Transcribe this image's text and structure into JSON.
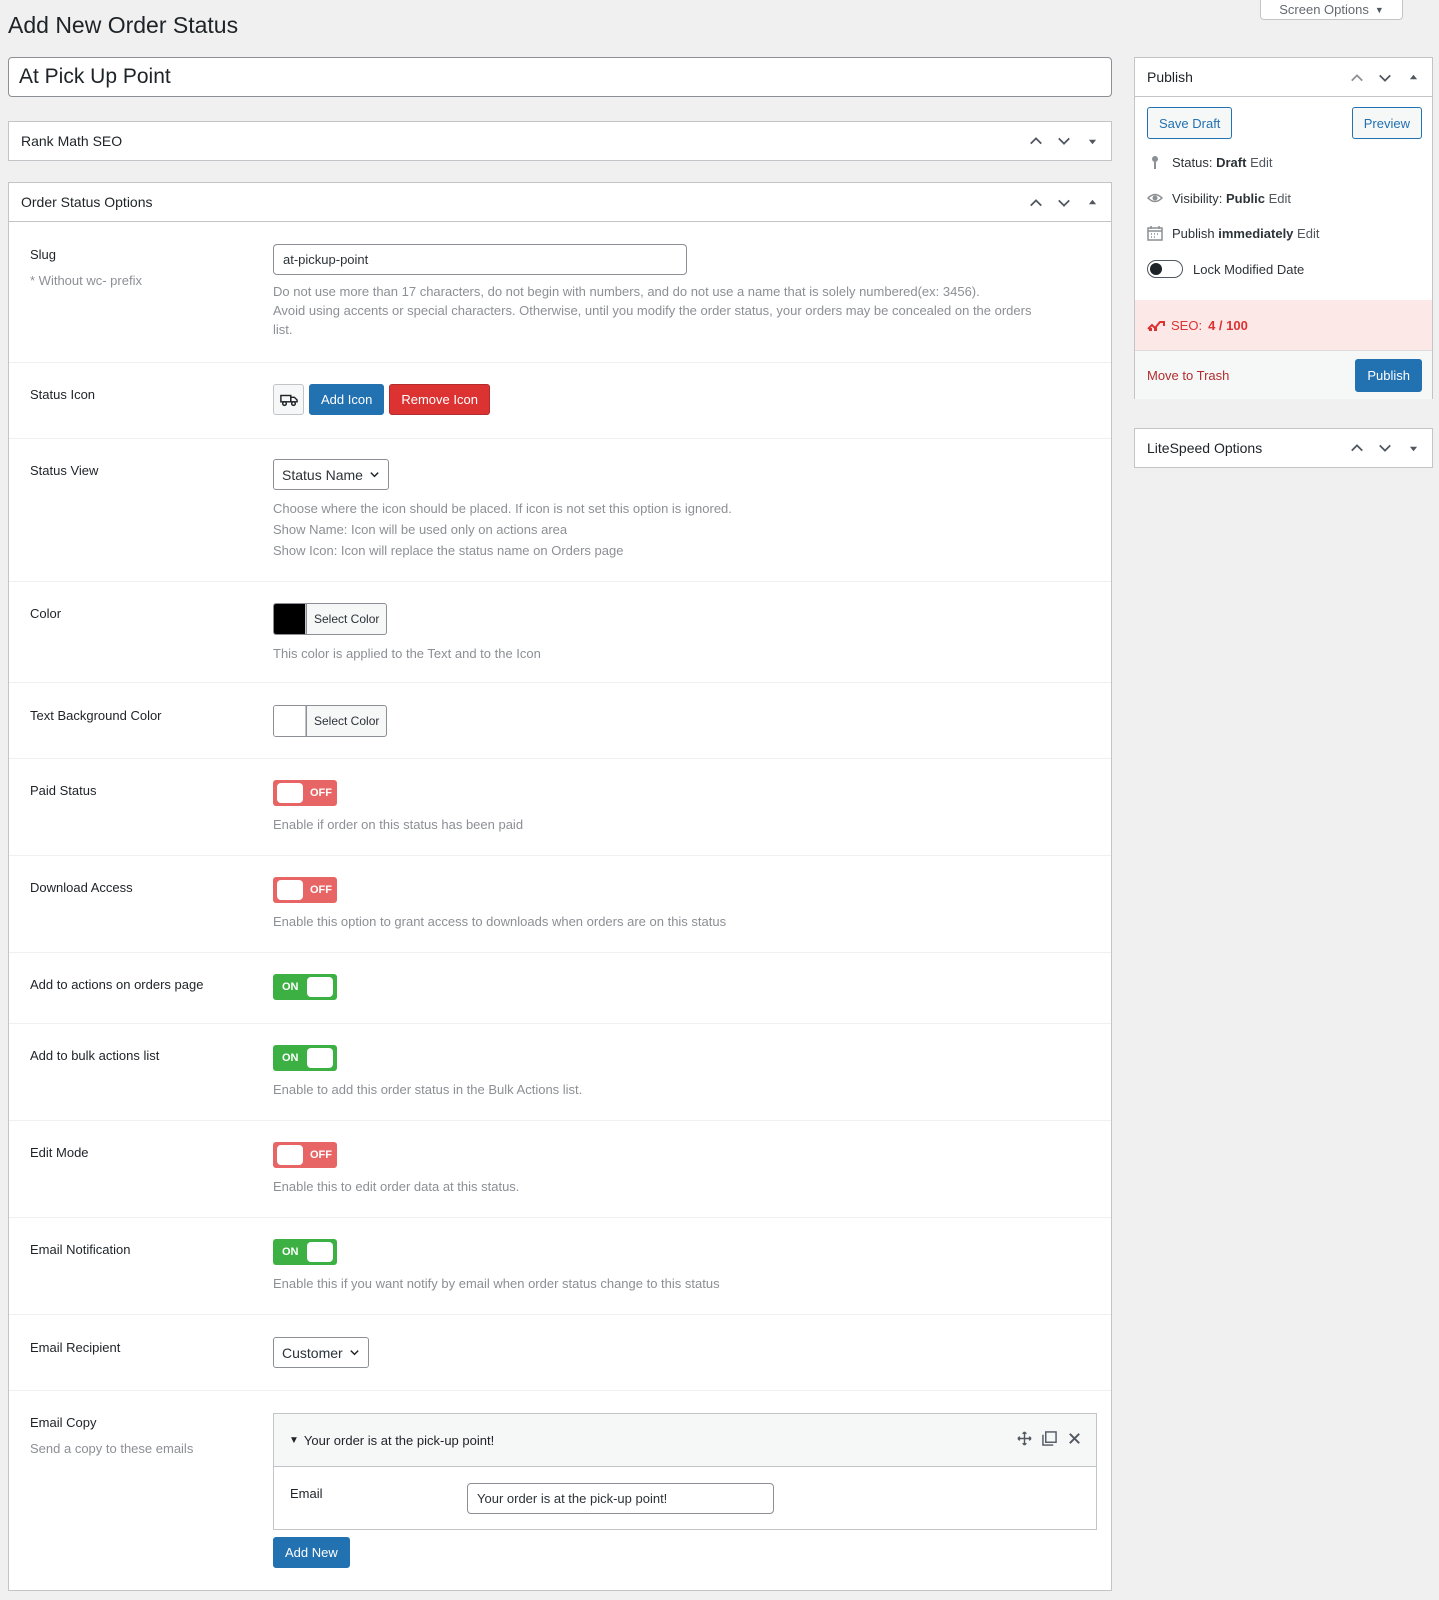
{
  "header": {
    "screen_options": "Screen Options",
    "page_title": "Add New Order Status"
  },
  "title_input": {
    "value": "At Pick Up Point"
  },
  "rank_math": {
    "title": "Rank Math SEO"
  },
  "order_status_options": {
    "title": "Order Status Options",
    "slug": {
      "label": "Slug",
      "sublabel": "* Without wc- prefix",
      "value": "at-pickup-point",
      "desc1": "Do not use more than 17 characters, do not begin with numbers, and do not use a name that is solely numbered(ex: 3456).",
      "desc2": "Avoid using accents or special characters. Otherwise, until you modify the order status, your orders may be concealed on the orders",
      "desc3": "list."
    },
    "status_icon": {
      "label": "Status Icon",
      "add": "Add Icon",
      "remove": "Remove Icon",
      "icon": "truck-icon"
    },
    "status_view": {
      "label": "Status View",
      "selected": "Status Name",
      "desc1": "Choose where the icon should be placed. If icon is not set this option is ignored.",
      "desc2": "Show Name: Icon will be used only on actions area",
      "desc3": "Show Icon: Icon will replace the status name on Orders page"
    },
    "color": {
      "label": "Color",
      "button": "Select Color",
      "swatch": "#000000",
      "desc": "This color is applied to the Text and to the Icon"
    },
    "text_bg_color": {
      "label": "Text Background Color",
      "button": "Select Color",
      "swatch": "#ffffff"
    },
    "paid_status": {
      "label": "Paid Status",
      "state": "OFF",
      "desc": "Enable if order on this status has been paid"
    },
    "download_access": {
      "label": "Download Access",
      "state": "OFF",
      "desc": "Enable this option to grant access to downloads when orders are on this status"
    },
    "add_actions": {
      "label": "Add to actions on orders page",
      "state": "ON"
    },
    "add_bulk": {
      "label": "Add to bulk actions list",
      "state": "ON",
      "desc": "Enable to add this order status in the Bulk Actions list."
    },
    "edit_mode": {
      "label": "Edit Mode",
      "state": "OFF",
      "desc": "Enable this to edit order data at this status."
    },
    "email_notification": {
      "label": "Email Notification",
      "state": "ON",
      "desc": "Enable this if you want notify by email when order status change to this status"
    },
    "email_recipient": {
      "label": "Email Recipient",
      "selected": "Customer"
    },
    "email_copy": {
      "label": "Email Copy",
      "sublabel": "Send a copy to these emails",
      "item_title": "Your order is at the pick-up point!",
      "email_label": "Email",
      "email_value": "Your order is at the pick-up point!",
      "add_new": "Add New"
    }
  },
  "publish": {
    "title": "Publish",
    "save_draft": "Save Draft",
    "preview": "Preview",
    "status_label": "Status:",
    "status_value": "Draft",
    "visibility_label": "Visibility:",
    "visibility_value": "Public",
    "publish_label": "Publish",
    "publish_value": "immediately",
    "edit": "Edit",
    "lock_label": "Lock Modified Date",
    "seo_label": "SEO:",
    "seo_value": "4 / 100",
    "trash": "Move to Trash",
    "publish_btn": "Publish"
  },
  "litespeed": {
    "title": "LiteSpeed Options"
  },
  "colors": {
    "accent": "#2271b1",
    "danger": "#dc3232",
    "toggle_off": "#e86565",
    "toggle_on": "#3cb043",
    "seo_bg": "#fde8e8",
    "seo_text": "#dc3232"
  }
}
